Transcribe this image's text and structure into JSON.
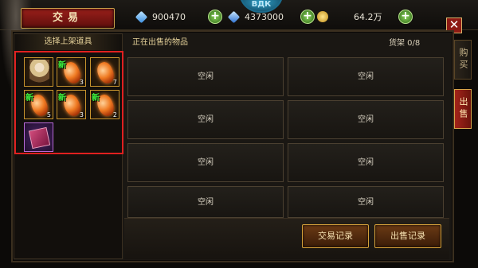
{
  "header": {
    "title": "交易",
    "emblem": "ВДК"
  },
  "resources": [
    {
      "icon": "diamond-icon",
      "value": "900470"
    },
    {
      "icon": "gem-icon",
      "value": "4373000"
    },
    {
      "icon": "gold-coin-icon",
      "value": "64.2万"
    }
  ],
  "left_panel": {
    "title": "选择上架道具",
    "items": [
      {
        "kind": "hero-card",
        "new": "",
        "count": ""
      },
      {
        "kind": "fire-crystal",
        "new": "新",
        "count": "3"
      },
      {
        "kind": "fire-crystal",
        "new": "",
        "count": "7"
      },
      {
        "kind": "fire-crystal",
        "new": "新",
        "count": "5"
      },
      {
        "kind": "fire-crystal",
        "new": "新",
        "count": "3"
      },
      {
        "kind": "fire-crystal",
        "new": "新",
        "count": "2"
      },
      {
        "kind": "purple-book",
        "new": "",
        "count": ""
      }
    ]
  },
  "right_panel": {
    "title": "正在出售的物品",
    "shelf": "货架 0/8",
    "slots": [
      "空闲",
      "空闲",
      "空闲",
      "空闲",
      "空闲",
      "空闲",
      "空闲",
      "空闲"
    ],
    "buttons": {
      "trade_record": "交易记录",
      "sell_record": "出售记录"
    }
  },
  "side_tabs": {
    "buy": "购买",
    "sell": "出售"
  },
  "close": "✕"
}
